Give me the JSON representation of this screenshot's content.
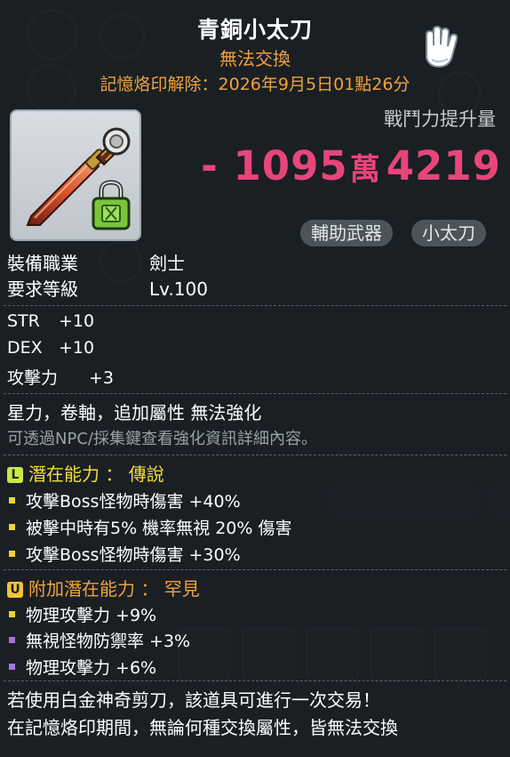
{
  "item": {
    "name": "青銅小太刀",
    "trade_status": "無法交換",
    "seal_line": "記憶烙印解除：2026年9月5日01點26分"
  },
  "combat_power": {
    "label": "戰鬥力提升量",
    "sign": "-",
    "value_high": "1095",
    "unit": "萬",
    "value_low": "4219"
  },
  "tags": [
    "輔助武器",
    "小太刀"
  ],
  "requirements": [
    {
      "label": "裝備職業",
      "value": "劍士"
    },
    {
      "label": "要求等級",
      "value": "Lv.100"
    }
  ],
  "stats": [
    {
      "name": "STR",
      "value": "+10"
    },
    {
      "name": "DEX",
      "value": "+10"
    },
    {
      "name": "攻擊力",
      "value": "+3"
    }
  ],
  "enhance": {
    "line": "星力，卷軸，追加屬性 無法強化",
    "hint": "可透過NPC/採集鍵查看強化資訊詳細內容。"
  },
  "potential": {
    "badge": "L",
    "title": "潛在能力 ： 傳說",
    "lines": [
      "攻擊Boss怪物時傷害 +40%",
      "被擊中時有5% 機率無視 20% 傷害",
      "攻擊Boss怪物時傷害 +30%"
    ]
  },
  "additional_potential": {
    "badge": "U",
    "title": "附加潛在能力 ： 罕見",
    "lines": [
      "物理攻擊力 +9%",
      "無視怪物防禦率 +3%",
      "物理攻擊力 +6%"
    ]
  },
  "footer": {
    "line1": "若使用白金神奇剪刀，該道具可進行一次交易！",
    "line2": "在記憶烙印期間，無論何種交換屬性，皆無法交換"
  },
  "colors": {
    "cp_value": "#e8457a",
    "trade_status": "#f0a23a",
    "potential_title": "#f2de3c",
    "additional_title": "#f0a23a",
    "bullet_yellow": "#e9d23a",
    "bullet_purple": "#a873e0"
  },
  "icons": [
    "glove-cursor-icon",
    "short-sword-icon",
    "lock-icon"
  ]
}
